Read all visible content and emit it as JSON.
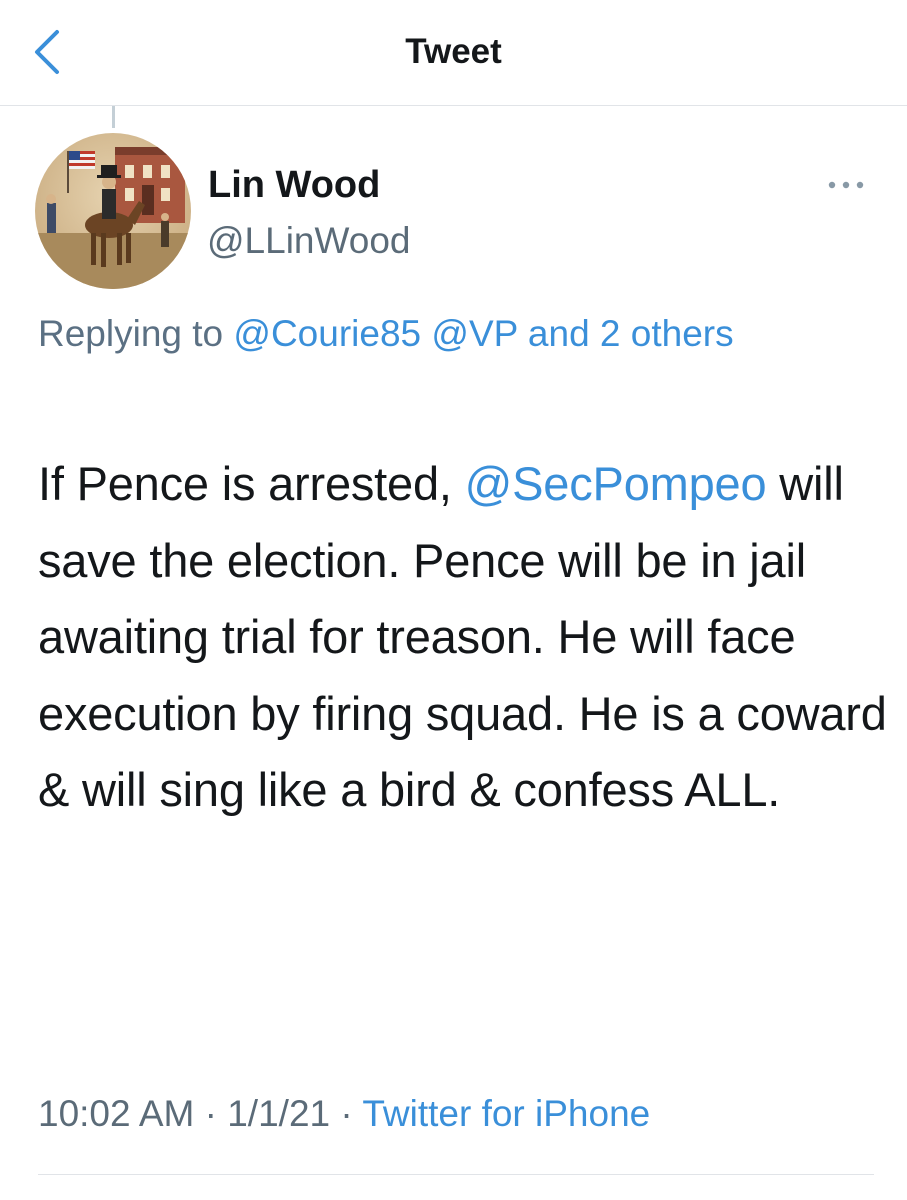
{
  "nav": {
    "title": "Tweet",
    "back_icon": "chevron-left-icon"
  },
  "author": {
    "display_name": "Lin Wood",
    "handle": "@LLinWood",
    "avatar_icon": "profile-avatar-painting"
  },
  "more_icon": "more-horizontal-icon",
  "reply": {
    "prefix": "Replying to ",
    "mentions": [
      "@Courie85",
      "@VP"
    ],
    "others": "and 2 others"
  },
  "tweet": {
    "text_part1": "If Pence is arrested, ",
    "mention": "@SecPompeo",
    "text_part2": " will save the election. Pence will be in jail awaiting trial for treason. He will face execution by firing squad. He is a coward & will sing like a bird & confess ALL."
  },
  "meta": {
    "time": "10:02 AM",
    "separator": " · ",
    "date": "1/1/21",
    "source": "Twitter for iPhone"
  },
  "colors": {
    "link": "#3a8fd9",
    "secondary_text": "#5b6b78",
    "primary_text": "#14171a",
    "divider": "#e1e4e8"
  }
}
